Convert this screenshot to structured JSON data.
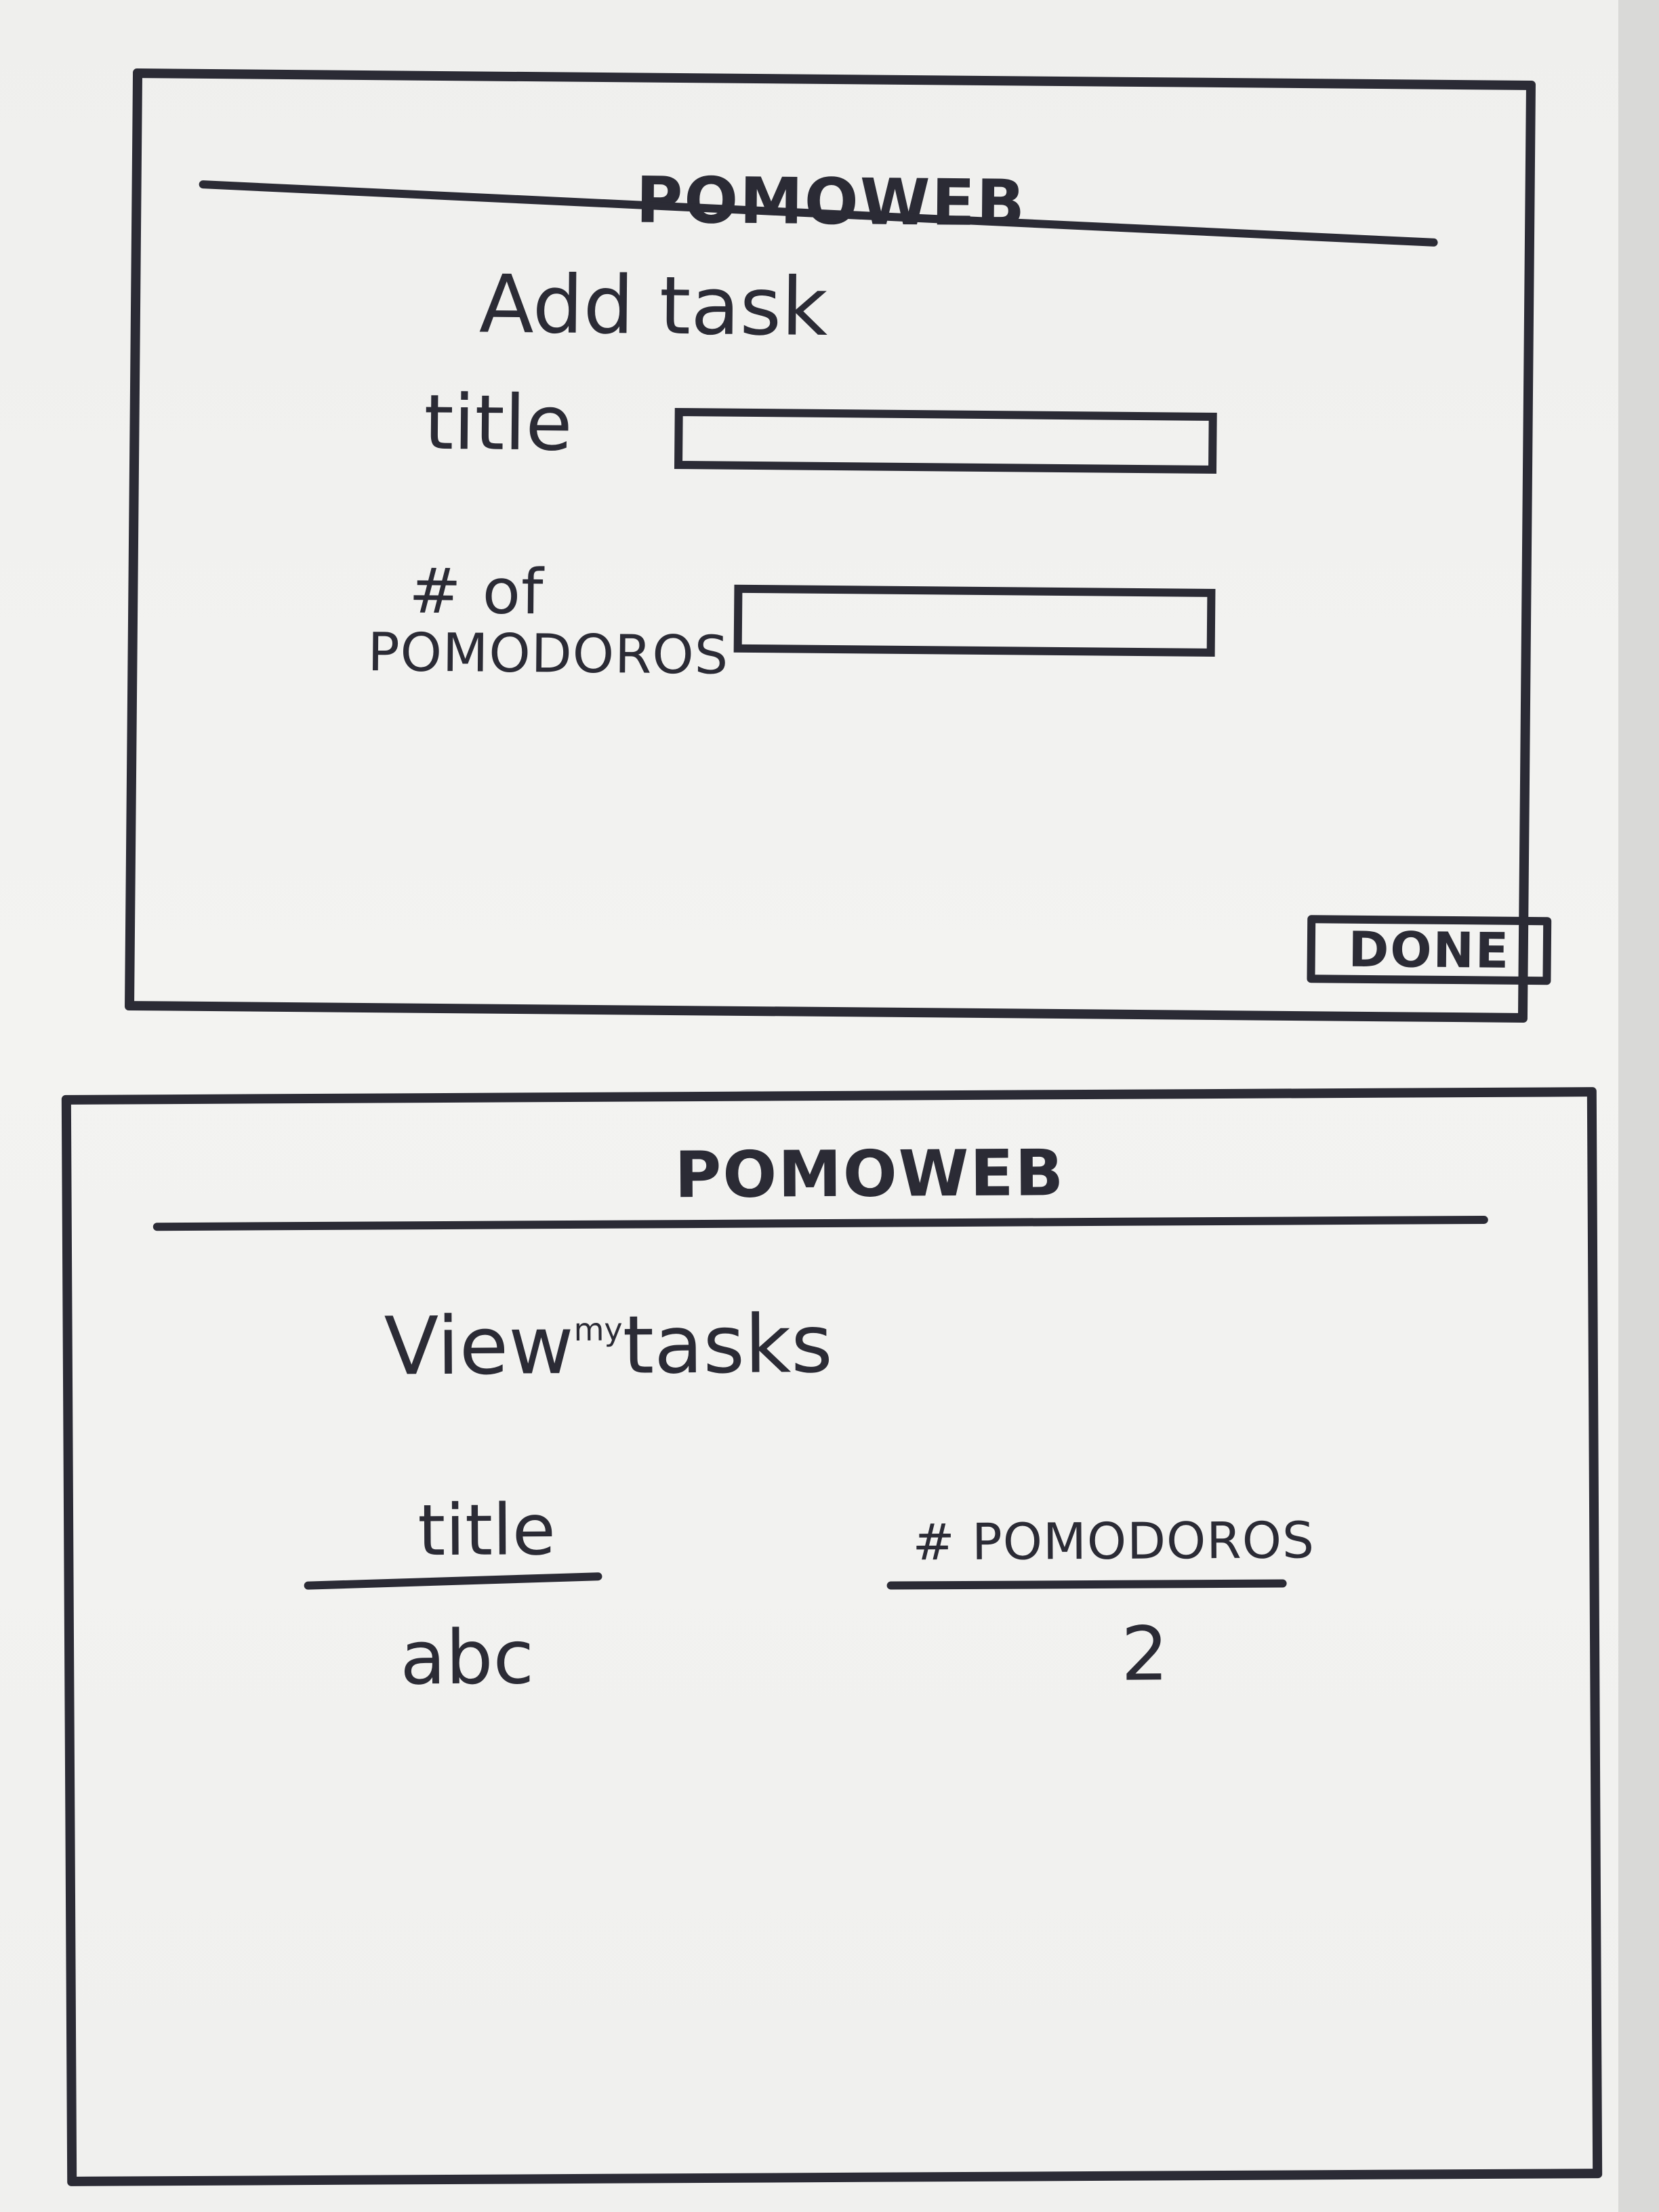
{
  "add_screen": {
    "brand": "POMOWEB",
    "heading": "Add task",
    "fields": [
      {
        "label": "title",
        "value": "",
        "placeholder": ""
      },
      {
        "label_line1": "# of",
        "label_line2": "POMODOROS",
        "value": "",
        "placeholder": ""
      }
    ],
    "done_label": "DONE"
  },
  "view_screen": {
    "brand": "POMOWEB",
    "heading_word1": "View",
    "heading_insert": "my",
    "heading_word2": "tasks",
    "table": {
      "columns": [
        "title",
        "# POMODOROS"
      ],
      "rows": [
        [
          "abc",
          "2"
        ]
      ]
    }
  }
}
